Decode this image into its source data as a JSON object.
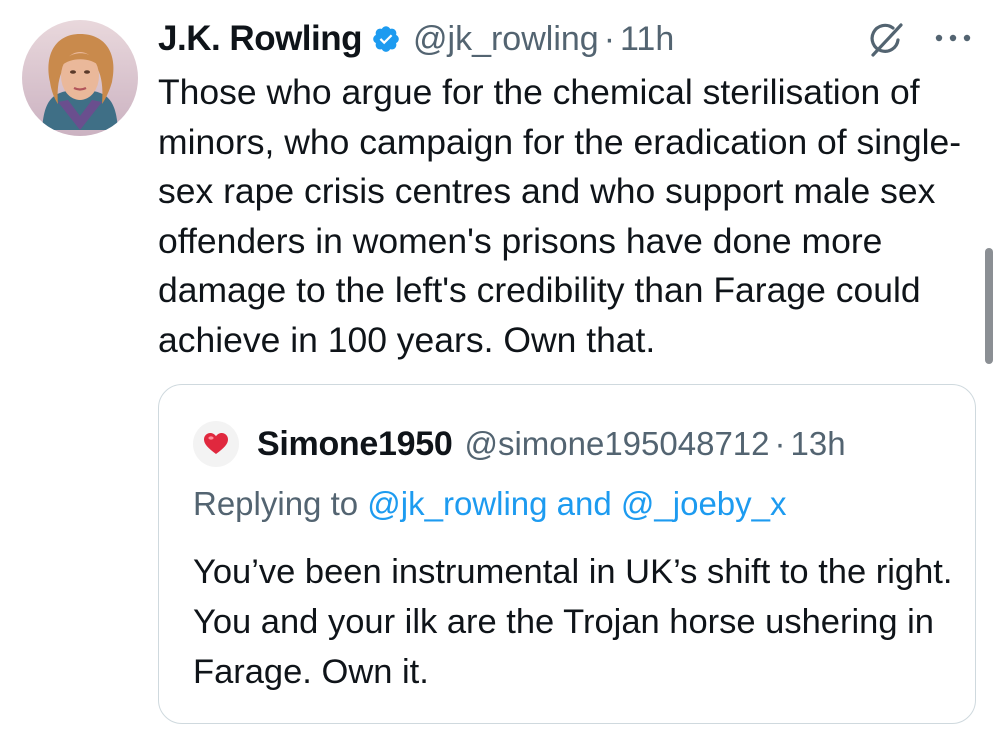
{
  "tweet": {
    "author_name": "J.K. Rowling",
    "author_handle": "@jk_rowling",
    "separator": "·",
    "time": "11h",
    "verified_icon": "verified-badge-icon",
    "text": "Those who argue for the chemical sterilisation of minors, who campaign for the eradication of single-sex rape crisis centres and who support male sex offenders in women's prisons have done more damage to the left's credibility than Farage could achieve in 100 years. Own that."
  },
  "quoted_tweet": {
    "author_name": "Simone1950",
    "author_handle": "@simone195048712",
    "separator": "·",
    "time": "13h",
    "replying_prefix": "Replying to ",
    "replying_user_1": "@jk_rowling",
    "replying_and": " and ",
    "replying_user_2": "@_joeby_x",
    "text": "You’ve been instrumental in UK’s shift to the right. You and your ilk are the Trojan horse ushering in Farage. Own it."
  },
  "icons": {
    "grok": "grok-icon",
    "more": "more-options-icon",
    "avatar_emoji": "heart-icon"
  },
  "colors": {
    "text_primary": "#0f1419",
    "text_secondary": "#536471",
    "link": "#1d9bf0",
    "verified": "#1d9bf0",
    "border": "#cfd9de"
  }
}
